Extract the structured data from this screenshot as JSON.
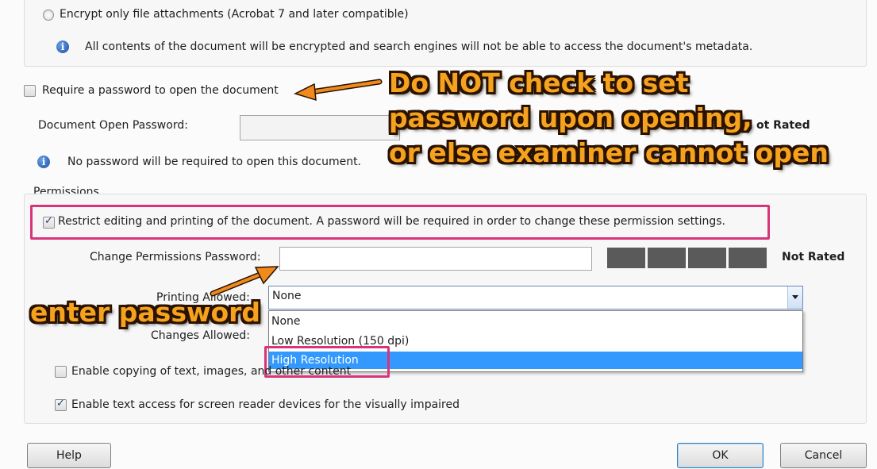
{
  "encryption": {
    "encrypt_attachments_label": "Encrypt only file attachments (Acrobat 7 and later compatible)",
    "info_text": "All contents of the document will be encrypted and search engines will not be able to access the document's metadata."
  },
  "open_password": {
    "require_label": "Require a password to open the document",
    "require_checked": false,
    "field_label": "Document Open Password:",
    "rating_label": "ot Rated",
    "info_text": "No password will be required to open this document."
  },
  "permissions": {
    "section_label": "Permissions",
    "restrict_label": "Restrict editing and printing of the document. A password will be required in order to change these permission settings.",
    "restrict_checked": true,
    "change_password_label": "Change Permissions Password:",
    "change_password_value": "",
    "rating_label": "Not Rated",
    "printing_label": "Printing Allowed:",
    "printing_value": "None",
    "printing_options": [
      "None",
      "Low Resolution (150 dpi)",
      "High Resolution"
    ],
    "printing_highlighted": "High Resolution",
    "changes_label": "Changes Allowed:",
    "copy_label": "Enable copying of text, images, and other content",
    "copy_checked": false,
    "screen_reader_label": "Enable text access for screen reader devices for the visually impaired",
    "screen_reader_checked": true
  },
  "buttons": {
    "help": "Help",
    "ok": "OK",
    "cancel": "Cancel"
  },
  "annotations": {
    "line1": "Do NOT check to set",
    "line2": "password upon opening,",
    "line3": "or else examiner cannot open",
    "enter_password": "enter password"
  },
  "colors": {
    "annotation_fill": "#f5a21e",
    "highlight_border": "#d9337a",
    "selected_item": "#3399ff"
  }
}
